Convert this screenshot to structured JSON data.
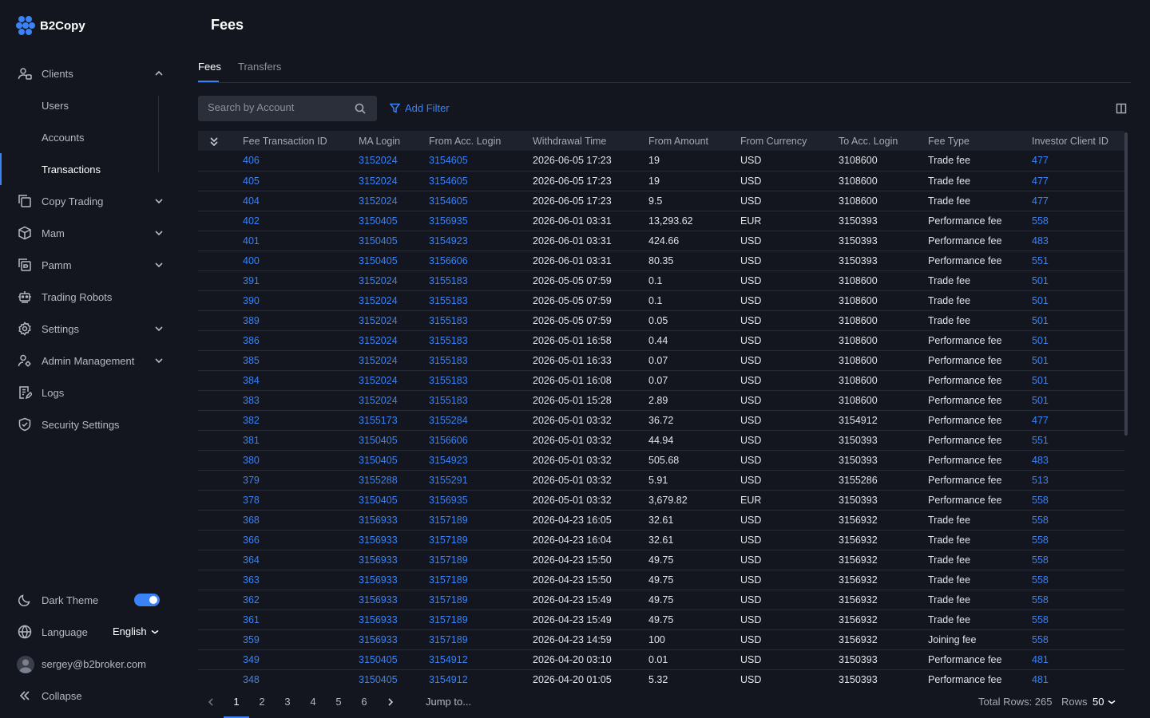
{
  "brand": {
    "name": "B2Copy",
    "accent": "#3b82f6"
  },
  "page": {
    "title": "Fees"
  },
  "sidebar": {
    "clients": {
      "label": "Clients",
      "sub": [
        "Users",
        "Accounts",
        "Transactions"
      ]
    },
    "items": [
      {
        "label": "Copy Trading",
        "icon": "copy-icon",
        "expandable": true
      },
      {
        "label": "Mam",
        "icon": "box-icon",
        "expandable": true
      },
      {
        "label": "Pamm",
        "icon": "pamm-icon",
        "expandable": true
      },
      {
        "label": "Trading Robots",
        "icon": "robot-icon",
        "expandable": false
      },
      {
        "label": "Settings",
        "icon": "gear-icon",
        "expandable": true
      },
      {
        "label": "Admin Management",
        "icon": "admin-icon",
        "expandable": true
      },
      {
        "label": "Logs",
        "icon": "logs-icon",
        "expandable": false
      },
      {
        "label": "Security Settings",
        "icon": "shield-icon",
        "expandable": false
      }
    ],
    "dark_theme": "Dark Theme",
    "language_label": "Language",
    "language_value": "English",
    "user_email": "sergey@b2broker.com",
    "collapse": "Collapse"
  },
  "tabs": [
    "Fees",
    "Transfers"
  ],
  "search": {
    "placeholder": "Search by Account"
  },
  "add_filter": "Add Filter",
  "table": {
    "columns": [
      "Fee Transaction ID",
      "MA Login",
      "From Acc. Login",
      "Withdrawal Time",
      "From Amount",
      "From Currency",
      "To Acc. Login",
      "Fee Type",
      "Investor Client ID"
    ],
    "rows": [
      [
        "406",
        "3152024",
        "3154605",
        "2026-06-05 17:23",
        "19",
        "USD",
        "3108600",
        "Trade fee",
        "477"
      ],
      [
        "405",
        "3152024",
        "3154605",
        "2026-06-05 17:23",
        "19",
        "USD",
        "3108600",
        "Trade fee",
        "477"
      ],
      [
        "404",
        "3152024",
        "3154605",
        "2026-06-05 17:23",
        "9.5",
        "USD",
        "3108600",
        "Trade fee",
        "477"
      ],
      [
        "402",
        "3150405",
        "3156935",
        "2026-06-01 03:31",
        "13,293.62",
        "EUR",
        "3150393",
        "Performance fee",
        "558"
      ],
      [
        "401",
        "3150405",
        "3154923",
        "2026-06-01 03:31",
        "424.66",
        "USD",
        "3150393",
        "Performance fee",
        "483"
      ],
      [
        "400",
        "3150405",
        "3156606",
        "2026-06-01 03:31",
        "80.35",
        "USD",
        "3150393",
        "Performance fee",
        "551"
      ],
      [
        "391",
        "3152024",
        "3155183",
        "2026-05-05 07:59",
        "0.1",
        "USD",
        "3108600",
        "Trade fee",
        "501"
      ],
      [
        "390",
        "3152024",
        "3155183",
        "2026-05-05 07:59",
        "0.1",
        "USD",
        "3108600",
        "Trade fee",
        "501"
      ],
      [
        "389",
        "3152024",
        "3155183",
        "2026-05-05 07:59",
        "0.05",
        "USD",
        "3108600",
        "Trade fee",
        "501"
      ],
      [
        "386",
        "3152024",
        "3155183",
        "2026-05-01 16:58",
        "0.44",
        "USD",
        "3108600",
        "Performance fee",
        "501"
      ],
      [
        "385",
        "3152024",
        "3155183",
        "2026-05-01 16:33",
        "0.07",
        "USD",
        "3108600",
        "Performance fee",
        "501"
      ],
      [
        "384",
        "3152024",
        "3155183",
        "2026-05-01 16:08",
        "0.07",
        "USD",
        "3108600",
        "Performance fee",
        "501"
      ],
      [
        "383",
        "3152024",
        "3155183",
        "2026-05-01 15:28",
        "2.89",
        "USD",
        "3108600",
        "Performance fee",
        "501"
      ],
      [
        "382",
        "3155173",
        "3155284",
        "2026-05-01 03:32",
        "36.72",
        "USD",
        "3154912",
        "Performance fee",
        "477"
      ],
      [
        "381",
        "3150405",
        "3156606",
        "2026-05-01 03:32",
        "44.94",
        "USD",
        "3150393",
        "Performance fee",
        "551"
      ],
      [
        "380",
        "3150405",
        "3154923",
        "2026-05-01 03:32",
        "505.68",
        "USD",
        "3150393",
        "Performance fee",
        "483"
      ],
      [
        "379",
        "3155288",
        "3155291",
        "2026-05-01 03:32",
        "5.91",
        "USD",
        "3155286",
        "Performance fee",
        "513"
      ],
      [
        "378",
        "3150405",
        "3156935",
        "2026-05-01 03:32",
        "3,679.82",
        "EUR",
        "3150393",
        "Performance fee",
        "558"
      ],
      [
        "368",
        "3156933",
        "3157189",
        "2026-04-23 16:05",
        "32.61",
        "USD",
        "3156932",
        "Trade fee",
        "558"
      ],
      [
        "366",
        "3156933",
        "3157189",
        "2026-04-23 16:04",
        "32.61",
        "USD",
        "3156932",
        "Trade fee",
        "558"
      ],
      [
        "364",
        "3156933",
        "3157189",
        "2026-04-23 15:50",
        "49.75",
        "USD",
        "3156932",
        "Trade fee",
        "558"
      ],
      [
        "363",
        "3156933",
        "3157189",
        "2026-04-23 15:50",
        "49.75",
        "USD",
        "3156932",
        "Trade fee",
        "558"
      ],
      [
        "362",
        "3156933",
        "3157189",
        "2026-04-23 15:49",
        "49.75",
        "USD",
        "3156932",
        "Trade fee",
        "558"
      ],
      [
        "361",
        "3156933",
        "3157189",
        "2026-04-23 15:49",
        "49.75",
        "USD",
        "3156932",
        "Trade fee",
        "558"
      ],
      [
        "359",
        "3156933",
        "3157189",
        "2026-04-23 14:59",
        "100",
        "USD",
        "3156932",
        "Joining fee",
        "558"
      ],
      [
        "349",
        "3150405",
        "3154912",
        "2026-04-20 03:10",
        "0.01",
        "USD",
        "3150393",
        "Performance fee",
        "481"
      ],
      [
        "348",
        "3150405",
        "3154912",
        "2026-04-20 01:05",
        "5.32",
        "USD",
        "3150393",
        "Performance fee",
        "481"
      ]
    ]
  },
  "pagination": {
    "pages": [
      "1",
      "2",
      "3",
      "4",
      "5",
      "6"
    ],
    "current": "1",
    "jump_to": "Jump to...",
    "total_rows": "Total Rows: 265",
    "rows_label": "Rows",
    "rows_value": "50"
  }
}
